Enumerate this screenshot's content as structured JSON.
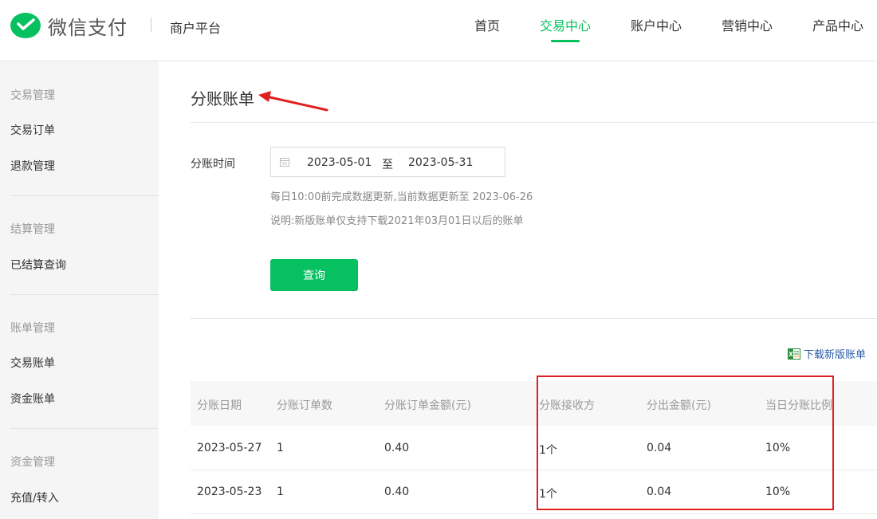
{
  "header": {
    "brand": "微信支付",
    "platform": "商户平台",
    "nav": [
      {
        "label": "首页",
        "active": false
      },
      {
        "label": "交易中心",
        "active": true
      },
      {
        "label": "账户中心",
        "active": false
      },
      {
        "label": "营销中心",
        "active": false
      },
      {
        "label": "产品中心",
        "active": false
      }
    ],
    "accent_color": "#07c160"
  },
  "sidebar": {
    "groups": [
      {
        "title": "交易管理",
        "items": [
          "交易订单",
          "退款管理"
        ]
      },
      {
        "title": "结算管理",
        "items": [
          "已结算查询"
        ]
      },
      {
        "title": "账单管理",
        "items": [
          "交易账单",
          "资金账单"
        ]
      },
      {
        "title": "资金管理",
        "items": [
          "充值/转入"
        ]
      }
    ]
  },
  "main": {
    "title": "分账账单",
    "filter": {
      "label": "分账时间",
      "start_date": "2023-05-01",
      "separator": "至",
      "end_date": "2023-05-31",
      "icon": "calendar-icon"
    },
    "hints": [
      "每日10:00前完成数据更新,当前数据更新至 2023-06-26",
      "说明:新版账单仅支持下载2021年03月01日以后的账单"
    ],
    "query_button": "查询",
    "download_link": "下载新版账单",
    "download_icon": "excel-icon",
    "table": {
      "columns": [
        "分账日期",
        "分账订单数",
        "分账订单金额(元)",
        "分账接收方",
        "分出金额(元)",
        "当日分账比例"
      ],
      "rows": [
        [
          "2023-05-27",
          "1",
          "0.40",
          "1个",
          "0.04",
          "10%"
        ],
        [
          "2023-05-23",
          "1",
          "0.40",
          "1个",
          "0.04",
          "10%"
        ]
      ]
    }
  },
  "annotation_color": "#e02020"
}
